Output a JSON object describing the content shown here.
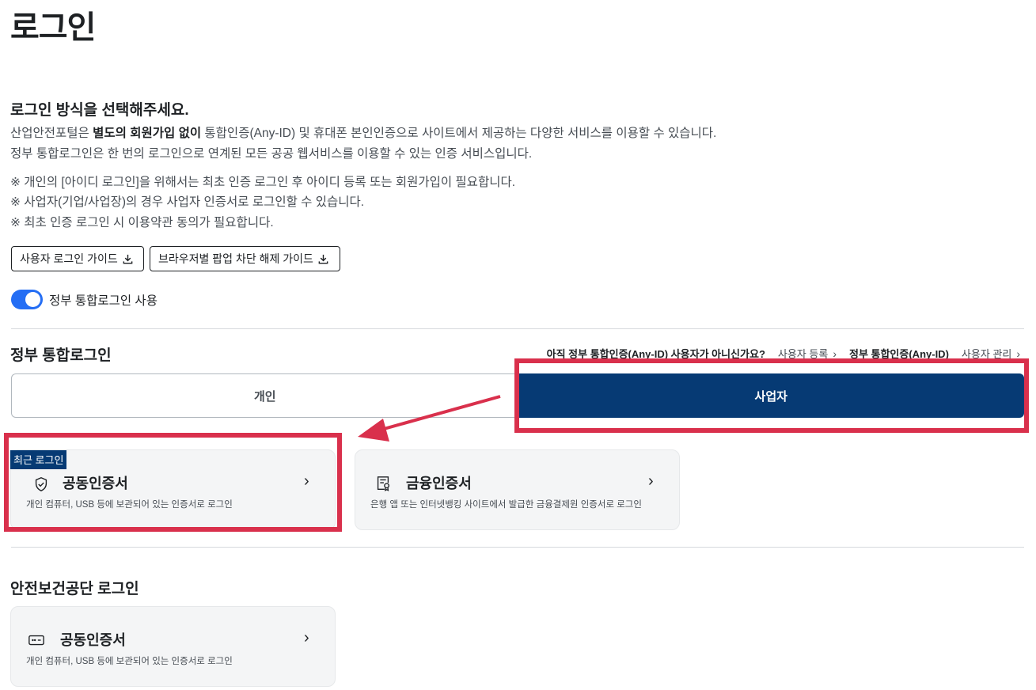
{
  "page": {
    "title": "로그인"
  },
  "intro": {
    "heading": "로그인 방식을 선택해주세요.",
    "line1_prefix": "산업안전포털은 ",
    "line1_bold": "별도의 회원가입 없이",
    "line1_suffix": " 통합인증(Any-ID) 및 휴대폰 본인인증으로 사이트에서 제공하는 다양한 서비스를 이용할 수 있습니다.",
    "line2": "정부 통합로그인은 한 번의 로그인으로 연계된 모든 공공 웹서비스를 이용할 수 있는 인증 서비스입니다.",
    "notes": [
      "※ 개인의 [아이디 로그인]을 위해서는 최초 인증 로그인 후 아이디 등록 또는 회원가입이 필요합니다.",
      "※ 사업자(기업/사업장)의 경우 사업자 인증서로 로그인할 수 있습니다.",
      "※ 최초 인증 로그인 시 이용약관 동의가 필요합니다."
    ]
  },
  "guides": {
    "user_guide": "사용자 로그인 가이드",
    "popup_guide": "브라우저별 팝업 차단 해제 가이드"
  },
  "toggle": {
    "label": "정부 통합로그인 사용",
    "on": true
  },
  "gov_login": {
    "title": "정부 통합로그인",
    "question": "아직 정부 통합인증(Any-ID) 사용자가 아니신가요?",
    "register_link": "사용자 등록",
    "any_id_label": "정부 통합인증(Any-ID)",
    "manage_link": "사용자 관리",
    "tabs": [
      {
        "label": "개인",
        "selected": false
      },
      {
        "label": "사업자",
        "selected": true
      }
    ],
    "recent_badge": "최근 로그인",
    "cards": [
      {
        "title": "공동인증서",
        "desc": "개인 컴퓨터, USB 등에 보관되어 있는 인증서로 로그인",
        "icon": "shield-check-icon"
      },
      {
        "title": "금융인증서",
        "desc": "은행 앱 또는 인터넷뱅킹 사이트에서 발급한 금융결제원 인증서로 로그인",
        "icon": "certificate-icon"
      }
    ]
  },
  "kosha_login": {
    "title": "안전보건공단 로그인",
    "cards": [
      {
        "title": "공동인증서",
        "desc": "개인 컴퓨터, USB 등에 보관되어 있는 인증서로 로그인",
        "icon": "card-reader-icon"
      }
    ]
  },
  "chevron_glyph": "›",
  "colors": {
    "primary_navy": "#063a74",
    "toggle_blue": "#256ef4",
    "highlight_red": "#d9304c",
    "card_bg": "#f4f5f6"
  }
}
